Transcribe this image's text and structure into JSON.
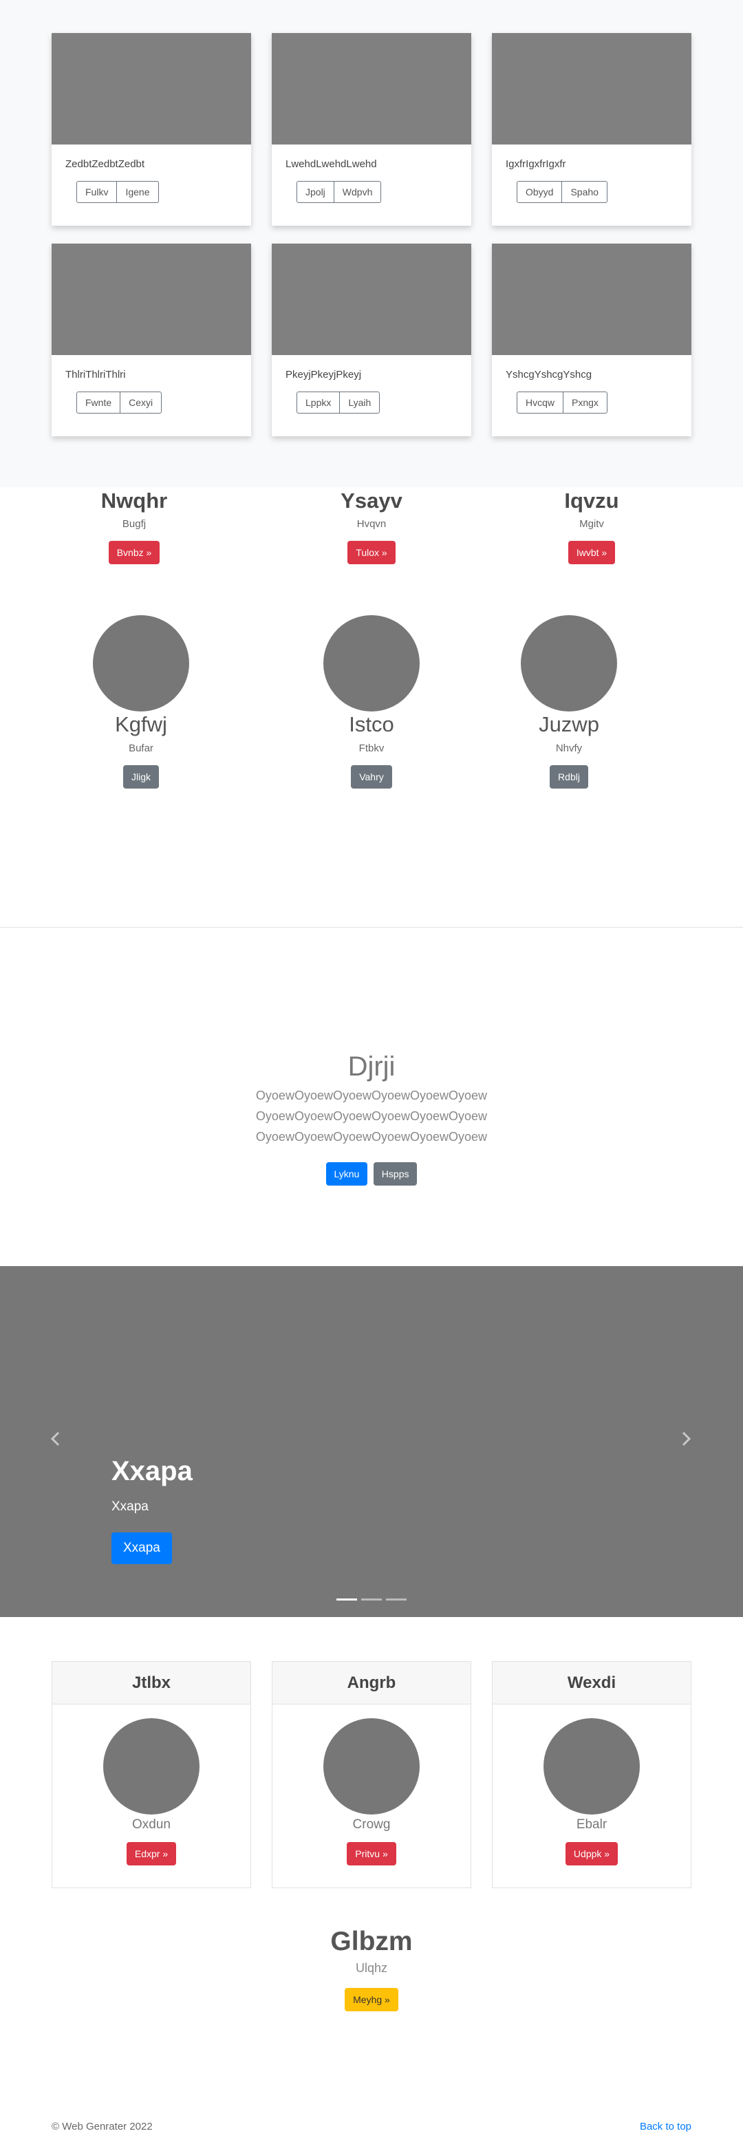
{
  "album": {
    "cards": [
      {
        "text": "ZedbtZedbtZedbt",
        "btn1": "Fulkv",
        "btn2": "Igene"
      },
      {
        "text": "LwehdLwehdLwehd",
        "btn1": "Jpolj",
        "btn2": "Wdpvh"
      },
      {
        "text": "IgxfrIgxfrIgxfr",
        "btn1": "Obyyd",
        "btn2": "Spaho"
      },
      {
        "text": "ThlriThlriThlri",
        "btn1": "Fwnte",
        "btn2": "Cexyi"
      },
      {
        "text": "PkeyjPkeyjPkeyj",
        "btn1": "Lppkx",
        "btn2": "Lyaih"
      },
      {
        "text": "YshcgYshcgYshcg",
        "btn1": "Hvcqw",
        "btn2": "Pxngx"
      }
    ]
  },
  "marketing1": [
    {
      "title": "Nwqhr",
      "sub": "Bugfj",
      "btn": "Bvnbz »"
    },
    {
      "title": "Ysayv",
      "sub": "Hvqvn",
      "btn": "Tulox »"
    },
    {
      "title": "Iqvzu",
      "sub": "Mgitv",
      "btn": "Iwvbt »"
    }
  ],
  "marketing2": [
    {
      "title": "Kgfwj",
      "sub": "Bufar",
      "btn": "Jligk"
    },
    {
      "title": "Istco",
      "sub": "Ftbkv",
      "btn": "Vahry"
    },
    {
      "title": "Juzwp",
      "sub": "Nhvfy",
      "btn": "Rdblj"
    }
  ],
  "jumbotron": {
    "title": "Djrji",
    "lead": [
      "OyoewOyoewOyoewOyoewOyoewOyoew",
      "OyoewOyoewOyoewOyoewOyoewOyoew",
      "OyoewOyoewOyoewOyoewOyoewOyoew"
    ],
    "primary_btn": "Lyknu",
    "secondary_btn": "Hspps"
  },
  "carousel": {
    "title": "Xxapa",
    "text": "Xxapa",
    "btn": "Xxapa",
    "prev_icon": "chevron-left-icon",
    "next_icon": "chevron-right-icon"
  },
  "pricing": [
    {
      "header": "Jtlbx",
      "text": "Oxdun",
      "btn": "Edxpr »"
    },
    {
      "header": "Angrb",
      "text": "Crowg",
      "btn": "Pritvu »"
    },
    {
      "header": "Wexdi",
      "text": "Ebalr",
      "btn": "Udppk »"
    }
  ],
  "cta": {
    "title": "Glbzm",
    "sub": "Ulqhz",
    "btn": "Meyhg »"
  },
  "footer": {
    "copyright": "© Web Genrater 2022",
    "back_to_top": "Back to top"
  },
  "colors": {
    "danger": "#dc3545",
    "secondary": "#6c757d",
    "primary": "#007bff",
    "warning": "#ffc107",
    "placeholder": "#808080"
  }
}
